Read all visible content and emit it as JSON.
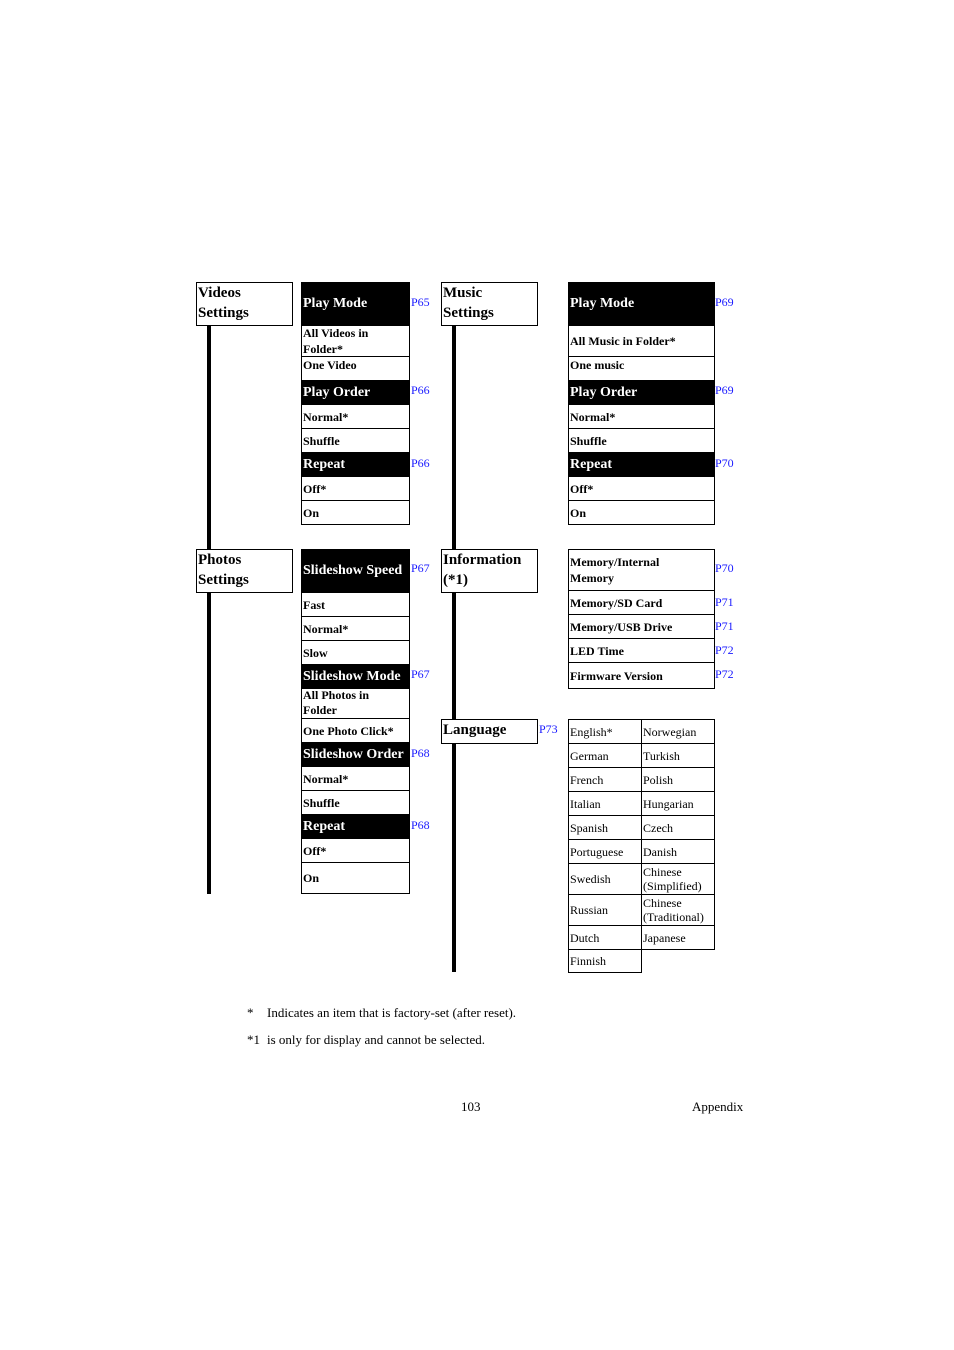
{
  "videos": {
    "title_line1": "Videos",
    "title_line2": "Settings",
    "play_mode": {
      "label": "Play Mode",
      "ref": "P65",
      "options": [
        "All Videos in",
        "Folder*",
        "One Video"
      ]
    },
    "play_order": {
      "label": "Play Order",
      "ref": "P66",
      "options": [
        "Normal*",
        "Shuffle"
      ]
    },
    "repeat": {
      "label": "Repeat",
      "ref": "P66",
      "options": [
        "Off*",
        "On"
      ]
    }
  },
  "music": {
    "title_line1": "Music",
    "title_line2": "Settings",
    "play_mode": {
      "label": "Play Mode",
      "ref": "P69",
      "options": [
        "All Music in Folder*",
        "One music"
      ]
    },
    "play_order": {
      "label": "Play Order",
      "ref": "P69",
      "options": [
        "Normal*",
        "Shuffle"
      ]
    },
    "repeat": {
      "label": "Repeat",
      "ref": "P70",
      "options": [
        "Off*",
        "On"
      ]
    }
  },
  "photos": {
    "title_line1": "Photos",
    "title_line2": "Settings",
    "slideshow_speed": {
      "label": "Slideshow Speed",
      "ref": "P67",
      "options": [
        "Fast",
        "Normal*",
        "Slow"
      ]
    },
    "slideshow_mode": {
      "label": "Slideshow Mode",
      "ref": "P67",
      "options": [
        "All Photos in",
        "Folder",
        "One Photo Click*"
      ]
    },
    "slideshow_order": {
      "label": "Slideshow Order",
      "ref": "P68",
      "options": [
        "Normal*",
        "Shuffle"
      ]
    },
    "repeat": {
      "label": "Repeat",
      "ref": "P68",
      "options": [
        "Off*",
        "On"
      ]
    }
  },
  "information": {
    "title_line1": "Information",
    "title_line2": "(*1)",
    "items": [
      {
        "label1": "Memory/Internal",
        "label2": "Memory",
        "ref": "P70"
      },
      {
        "label1": "Memory/SD Card",
        "ref": "P71"
      },
      {
        "label1": "Memory/USB Drive",
        "ref": "P71"
      },
      {
        "label1": "LED Time",
        "ref": "P72"
      },
      {
        "label1": "Firmware Version",
        "ref": "P72"
      }
    ]
  },
  "language": {
    "title": "Language",
    "ref": "P73",
    "col1": [
      "English*",
      "German",
      "French",
      "Italian",
      "Spanish",
      "Portuguese",
      "Swedish",
      "Russian",
      "Dutch",
      "Finnish"
    ],
    "col2": [
      "Norwegian",
      "Turkish",
      "Polish",
      "Hungarian",
      "Czech",
      "Danish",
      "Chinese",
      "Chinese",
      "Japanese"
    ],
    "col2_line2": {
      "6": "(Simplified)",
      "7": "(Traditional)"
    }
  },
  "notes": {
    "n1_mark": "*",
    "n1_text": "Indicates an item that is factory-set (after reset).",
    "n2_mark": "*1",
    "n2_text": "is only for display and cannot be selected."
  },
  "footer": {
    "page_number": "103",
    "section": "Appendix"
  }
}
